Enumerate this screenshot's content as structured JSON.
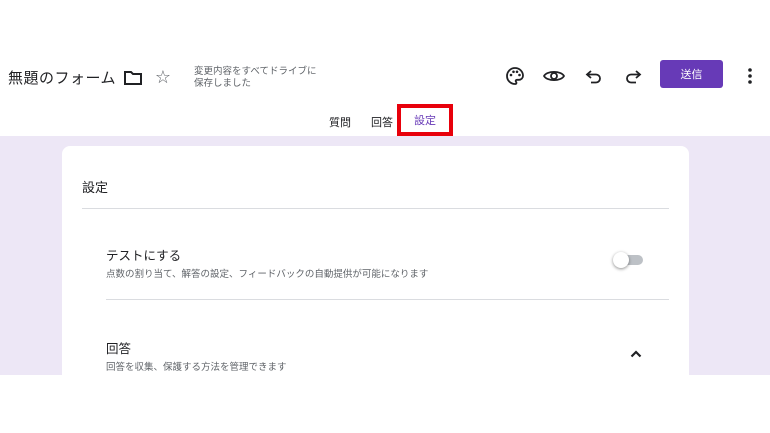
{
  "header": {
    "form_title": "無題のフォーム",
    "saved_status_line1": "変更内容をすべてドライブに",
    "saved_status_line2": "保存しました",
    "send_label": "送信"
  },
  "tabs": [
    {
      "label": "質問"
    },
    {
      "label": "回答"
    },
    {
      "label": "設定",
      "selected": true
    }
  ],
  "settings": {
    "title": "設定",
    "quiz": {
      "title": "テストにする",
      "description": "点数の割り当て、解答の設定、フィードバックの自動提供が可能になります",
      "enabled": false
    },
    "responses": {
      "title": "回答",
      "description": "回答を収集、保護する方法を管理できます",
      "expanded": true
    }
  },
  "icons": [
    "folder-icon",
    "star-icon",
    "palette-icon",
    "eye-icon",
    "undo-icon",
    "redo-icon",
    "more-vert-icon",
    "chevron-up-icon"
  ],
  "colors": {
    "accent": "#673ab7",
    "highlight_box": "#e8000b",
    "page_background": "#ede7f6"
  }
}
